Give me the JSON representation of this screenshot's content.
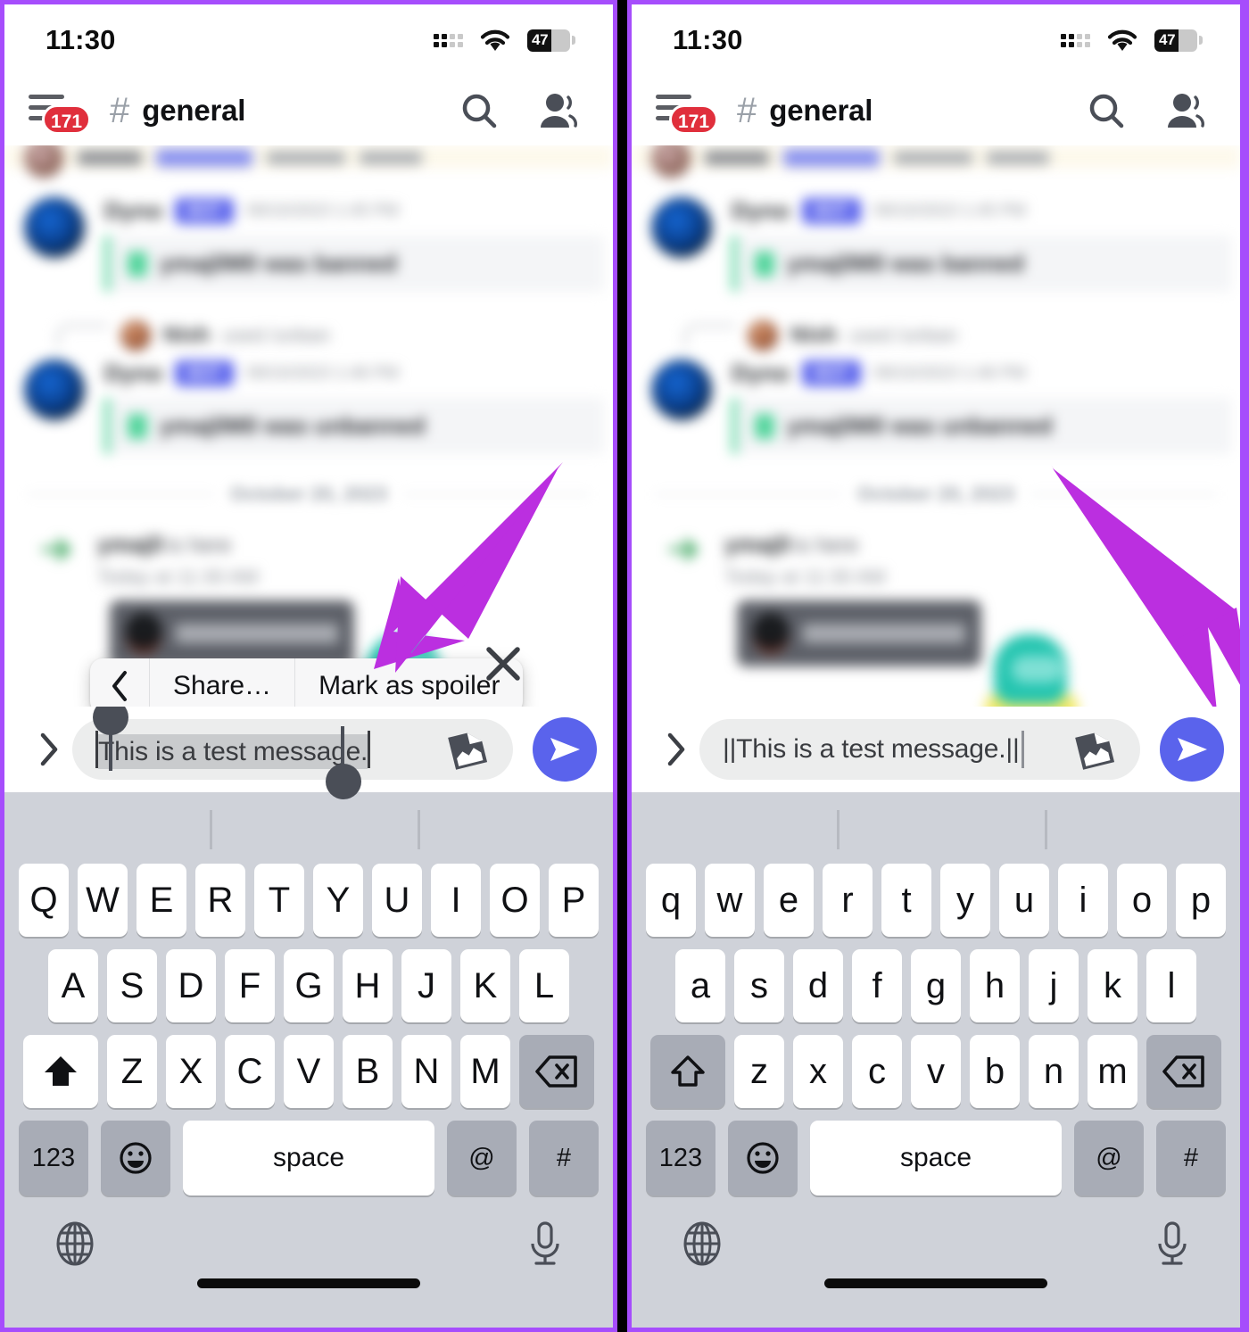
{
  "meta": {
    "accent_purple": "#a64dfc",
    "arrow_purple": "#bb2fe0",
    "brand_blurple": "#5a63ec",
    "badge_red": "#e02f3c"
  },
  "status_bar": {
    "time": "11:30",
    "battery_percent": "47",
    "signal_icon": "cellular-signal-icon",
    "wifi_icon": "wifi-icon",
    "battery_icon": "battery-icon"
  },
  "app_bar": {
    "menu_icon": "hamburger-menu-icon",
    "unread_badge": "171",
    "hash_symbol": "#",
    "channel_name": "general",
    "search_icon": "search-icon",
    "members_icon": "members-icon"
  },
  "chat": {
    "messages": [
      {
        "username": "Dyno",
        "tag": "BOT",
        "timestamp": "09/10/2023 1:45 PM",
        "embed_text": "ymaj0M0 was banned"
      },
      {
        "username": "Nish",
        "action": "used /unban",
        "type": "reply-ref"
      },
      {
        "username": "Dyno",
        "tag": "BOT",
        "timestamp": "09/10/2023 1:46 PM",
        "embed_text": "ymaj0M0 was unbanned"
      }
    ],
    "date_divider": "October 20, 2023",
    "join_message": {
      "name": "ymaj0",
      "text": "is here",
      "subtext": "Today at 11:30 AM"
    },
    "gif_card_label": "Wave To say Hi",
    "sticker_name": "among-us-sticker"
  },
  "context_menu": {
    "back_icon": "chevron-left-icon",
    "items": [
      "Share…",
      "Mark as spoiler"
    ],
    "close_icon": "close-icon"
  },
  "composer": {
    "expand_icon": "chevron-right-icon",
    "left_value": "This is a test message.",
    "right_value": "||This is a test message.||",
    "attachment_icon": "attachment-gif-icon",
    "send_icon": "send-icon"
  },
  "keyboard": {
    "left": {
      "shift_state": "uppercase",
      "row1": [
        "Q",
        "W",
        "E",
        "R",
        "T",
        "Y",
        "U",
        "I",
        "O",
        "P"
      ],
      "row2": [
        "A",
        "S",
        "D",
        "F",
        "G",
        "H",
        "J",
        "K",
        "L"
      ],
      "row3": [
        "Z",
        "X",
        "C",
        "V",
        "B",
        "N",
        "M"
      ],
      "shift_icon": "shift-filled-icon",
      "backspace_icon": "backspace-icon",
      "numeric_label": "123",
      "emoji_icon": "emoji-icon",
      "space_label": "space",
      "at_label": "@",
      "hash_label": "#"
    },
    "right": {
      "shift_state": "lowercase",
      "row1": [
        "q",
        "w",
        "e",
        "r",
        "t",
        "y",
        "u",
        "i",
        "o",
        "p"
      ],
      "row2": [
        "a",
        "s",
        "d",
        "f",
        "g",
        "h",
        "j",
        "k",
        "l"
      ],
      "row3": [
        "z",
        "x",
        "c",
        "v",
        "b",
        "n",
        "m"
      ],
      "shift_icon": "shift-outline-icon",
      "backspace_icon": "backspace-icon",
      "numeric_label": "123",
      "emoji_icon": "emoji-icon",
      "space_label": "space",
      "at_label": "@",
      "hash_label": "#"
    },
    "globe_icon": "globe-language-icon",
    "mic_icon": "microphone-icon",
    "home_indicator": "home-indicator"
  },
  "annotations": [
    {
      "name": "arrow-mark-as-spoiler",
      "target": "Mark as spoiler"
    },
    {
      "name": "arrow-send-button",
      "target": "send-button"
    }
  ]
}
